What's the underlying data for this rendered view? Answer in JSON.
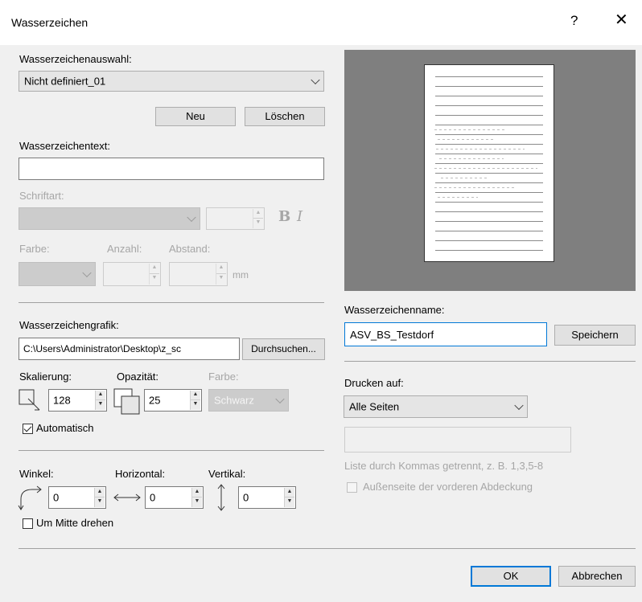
{
  "window": {
    "title": "Wasserzeichen",
    "help_label": "?",
    "close_label": "✕"
  },
  "selection": {
    "label": "Wasserzeichenauswahl:",
    "value": "Nicht definiert_01",
    "new_label": "Neu",
    "delete_label": "Löschen"
  },
  "text_section": {
    "label": "Wasserzeichentext:",
    "value": "",
    "font_label": "Schriftart:",
    "font_value": "",
    "size_value": "",
    "bold_label": "B",
    "italic_label": "I",
    "color_label": "Farbe:",
    "count_label": "Anzahl:",
    "spacing_label": "Abstand:",
    "count_value": "",
    "spacing_value": "",
    "unit_label": "mm"
  },
  "graphic_section": {
    "label": "Wasserzeichengrafik:",
    "path_value": "C:\\Users\\Administrator\\Desktop\\z_sc",
    "browse_label": "Durchsuchen...",
    "scale_label": "Skalierung:",
    "scale_value": "128",
    "opacity_label": "Opazität:",
    "opacity_value": "25",
    "color_label": "Farbe:",
    "color_value": "Schwarz",
    "auto_label": "Automatisch",
    "auto_checked": true
  },
  "position_section": {
    "angle_label": "Winkel:",
    "angle_value": "0",
    "horizontal_label": "Horizontal:",
    "horizontal_value": "0",
    "vertical_label": "Vertikal:",
    "vertical_value": "0",
    "rotate_label": "Um Mitte drehen",
    "rotate_checked": false
  },
  "right_panel": {
    "name_label": "Wasserzeichenname:",
    "name_value": "ASV_BS_Testdorf",
    "save_label": "Speichern",
    "print_label": "Drucken auf:",
    "print_value": "Alle Seiten",
    "pages_value": "",
    "pages_hint": "Liste durch Kommas getrennt, z. B. 1,3,5-8",
    "outside_label": "Außenseite der vorderen Abdeckung",
    "outside_checked": false
  },
  "footer": {
    "ok_label": "OK",
    "cancel_label": "Abbrechen"
  },
  "colors": {
    "dialog_bg": "#f0f0f0",
    "accent": "#0078d7",
    "preview_bg": "#7f7f7f"
  }
}
